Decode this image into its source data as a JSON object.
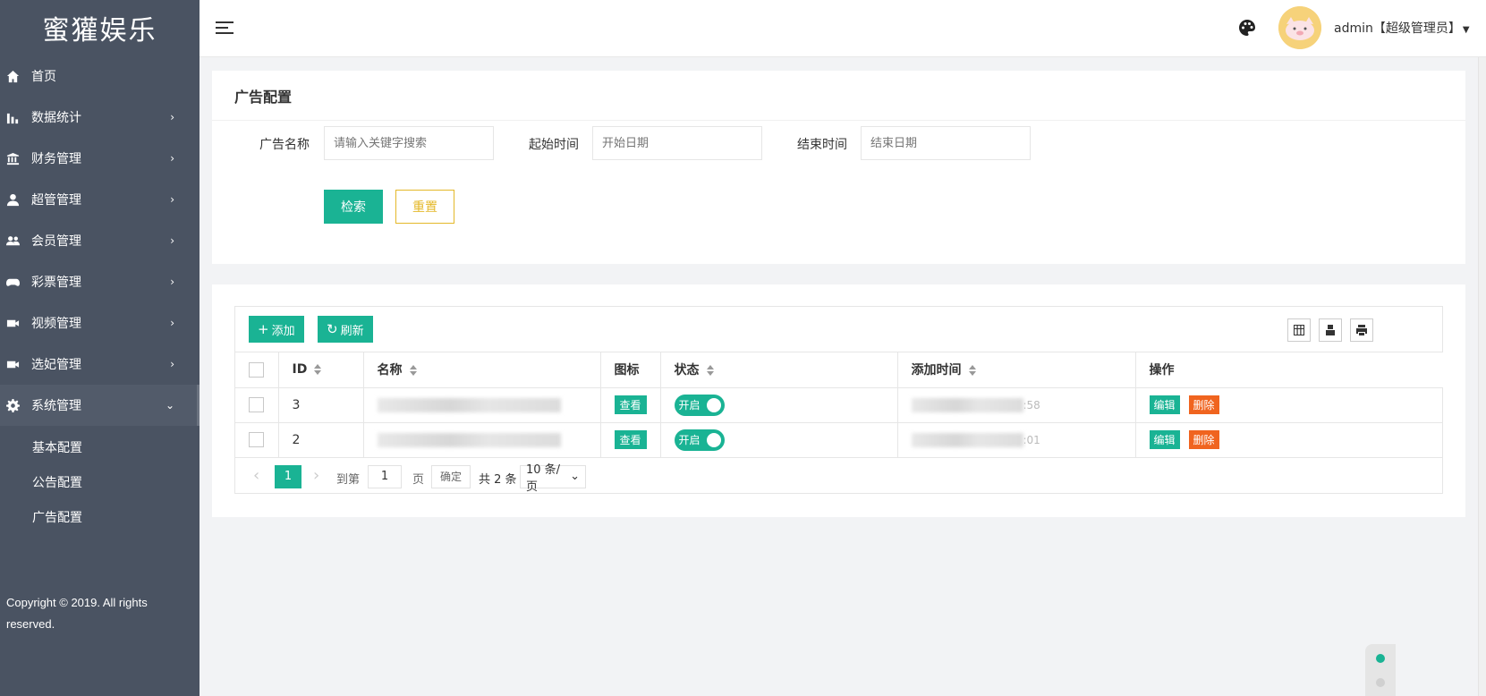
{
  "app": {
    "title": "蜜獾娱乐"
  },
  "sidebar": {
    "items": [
      {
        "label": "首页",
        "icon": "home-icon",
        "arrow": ""
      },
      {
        "label": "数据统计",
        "icon": "bar-chart-icon",
        "arrow": "›"
      },
      {
        "label": "财务管理",
        "icon": "bank-icon",
        "arrow": "›"
      },
      {
        "label": "超管管理",
        "icon": "user-icon",
        "arrow": "›"
      },
      {
        "label": "会员管理",
        "icon": "users-icon",
        "arrow": "›"
      },
      {
        "label": "彩票管理",
        "icon": "gamepad-icon",
        "arrow": "›"
      },
      {
        "label": "视频管理",
        "icon": "video-icon",
        "arrow": "›"
      },
      {
        "label": "选妃管理",
        "icon": "video-icon",
        "arrow": "›"
      },
      {
        "label": "系统管理",
        "icon": "gear-icon",
        "arrow": "⌄"
      }
    ],
    "subitems": [
      "基本配置",
      "公告配置",
      "广告配置"
    ],
    "copyright": "Copyright © 2019. All rights reserved."
  },
  "header": {
    "user": "admin【超级管理员】",
    "caret": "▼"
  },
  "filter": {
    "title": "广告配置",
    "name_label": "广告名称",
    "name_placeholder": "请输入关键字搜索",
    "start_label": "起始时间",
    "start_placeholder": "开始日期",
    "end_label": "结束时间",
    "end_placeholder": "结束日期",
    "search_label": "检索",
    "reset_label": "重置"
  },
  "toolbar": {
    "add_label": "添加",
    "add_glyph": "+",
    "refresh_label": "刷新",
    "refresh_glyph": "↻"
  },
  "table": {
    "columns": [
      "ID",
      "名称",
      "图标",
      "状态",
      "添加时间",
      "操作"
    ],
    "rows": [
      {
        "id": "3",
        "view": "查看",
        "status": "开启",
        "edit": "编辑",
        "delete": "删除",
        "time_tail": ":58"
      },
      {
        "id": "2",
        "view": "查看",
        "status": "开启",
        "edit": "编辑",
        "delete": "删除",
        "time_tail": ":01"
      }
    ]
  },
  "pager": {
    "prev": "‹",
    "current": "1",
    "next": "›",
    "goto": "到第",
    "page_value": "1",
    "page_unit": "页",
    "confirm": "确定",
    "total": "共 2 条",
    "per_page": "10 条/页",
    "per_page_caret": "⌄"
  },
  "colors": {
    "accent": "#1ab394",
    "danger": "#f0641f",
    "reset": "#e4b829",
    "sidebar": "#4a5362"
  }
}
